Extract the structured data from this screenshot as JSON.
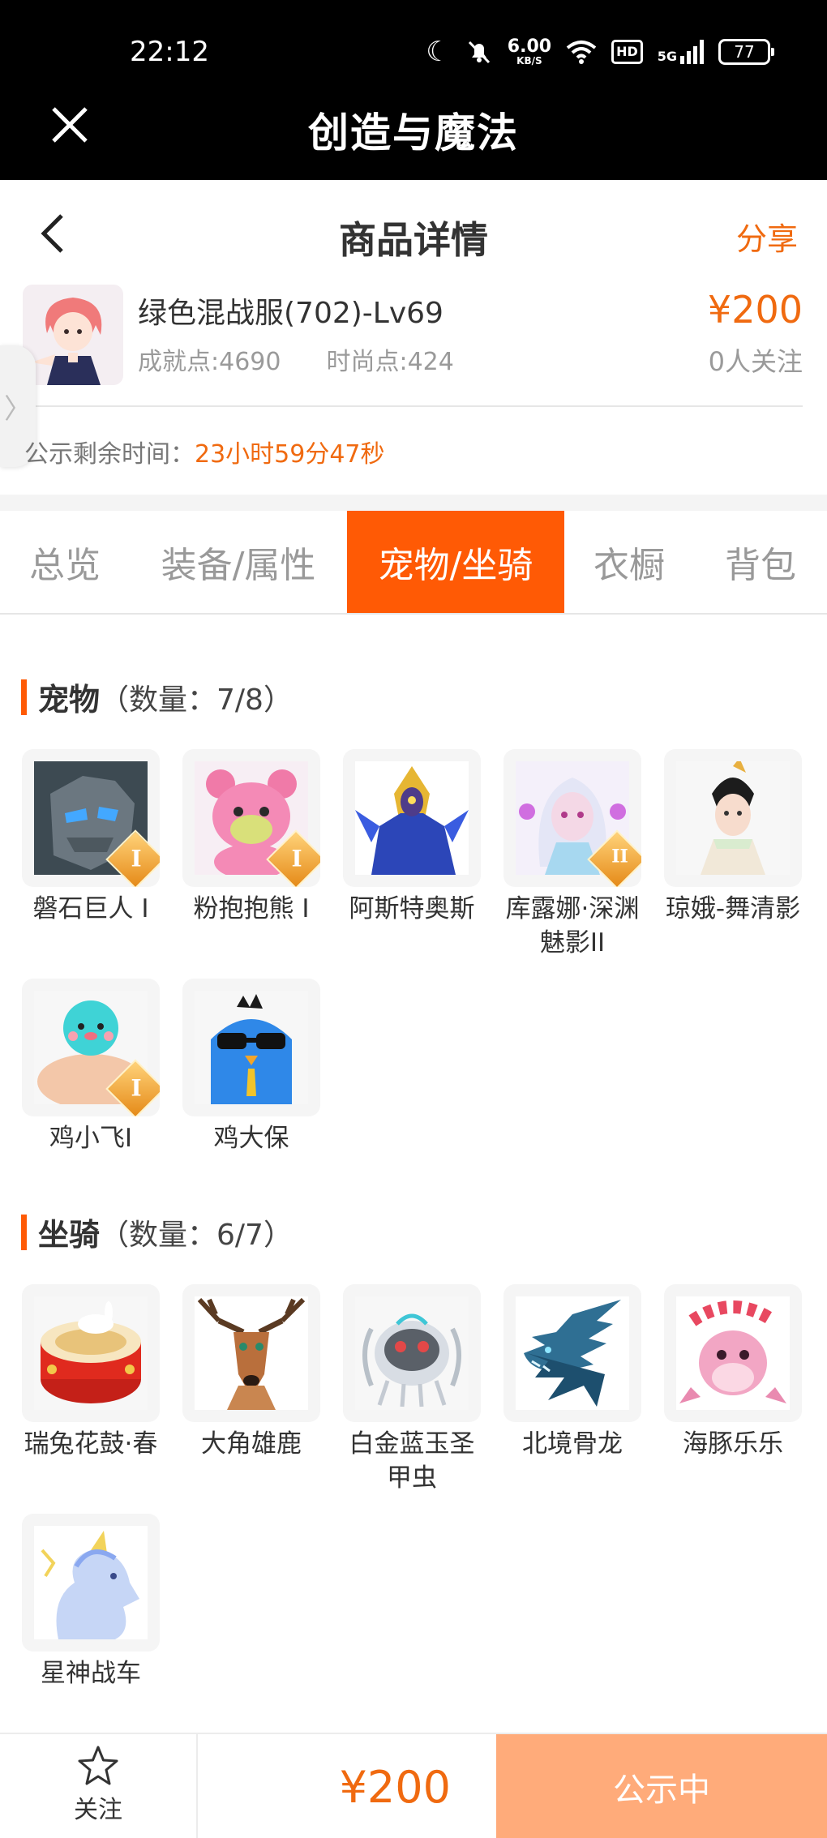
{
  "status_bar": {
    "time": "22:12",
    "net_speed": "6.00",
    "net_unit": "KB/S",
    "hd": "HD",
    "net_type": "5G",
    "battery": "77"
  },
  "app_bar": {
    "title": "创造与魔法"
  },
  "header": {
    "title": "商品详情",
    "share": "分享"
  },
  "product": {
    "name": "绿色混战服(702)-Lv69",
    "achievement": "成就点:4690",
    "fashion": "时尚点:424",
    "price": "¥200",
    "followers": "0人关注",
    "countdown_label": "公示剩余时间：",
    "countdown_value": "23小时59分47秒"
  },
  "tabs": [
    {
      "label": "总览"
    },
    {
      "label": "装备/属性"
    },
    {
      "label": "宠物/坐骑",
      "active": true
    },
    {
      "label": "衣橱"
    },
    {
      "label": "背包"
    }
  ],
  "pets": {
    "title": "宠物",
    "count": "（数量：7/8）",
    "items": [
      {
        "name": "磐石巨人 I",
        "tier": "I",
        "icon": "rock-golem-icon"
      },
      {
        "name": "粉抱抱熊 I",
        "tier": "I",
        "icon": "pink-bear-icon"
      },
      {
        "name": "阿斯特奥斯",
        "icon": "astraeus-icon"
      },
      {
        "name": "库露娜·深渊魅影II",
        "tier": "II",
        "icon": "kuluna-icon"
      },
      {
        "name": "琼娥-舞清影",
        "icon": "qiong-e-icon"
      },
      {
        "name": "鸡小飞I",
        "tier": "I",
        "icon": "chick-icon"
      },
      {
        "name": "鸡大保",
        "icon": "blue-bird-icon"
      }
    ]
  },
  "mounts": {
    "title": "坐骑",
    "count": "（数量：6/7）",
    "items": [
      {
        "name": "瑞兔花鼓·春",
        "icon": "rabbit-drum-icon"
      },
      {
        "name": "大角雄鹿",
        "icon": "stag-icon"
      },
      {
        "name": "白金蓝玉圣甲虫",
        "icon": "scarab-icon"
      },
      {
        "name": "北境骨龙",
        "icon": "bone-dragon-icon"
      },
      {
        "name": "海豚乐乐",
        "icon": "dolphin-icon"
      },
      {
        "name": "星神战车",
        "icon": "star-chariot-icon"
      }
    ]
  },
  "bottom": {
    "follow": "关注",
    "price": "¥200",
    "status": "公示中"
  },
  "colors": {
    "accent": "#ff5a05",
    "price": "#f06a10",
    "status_button": "#ffab7a"
  }
}
